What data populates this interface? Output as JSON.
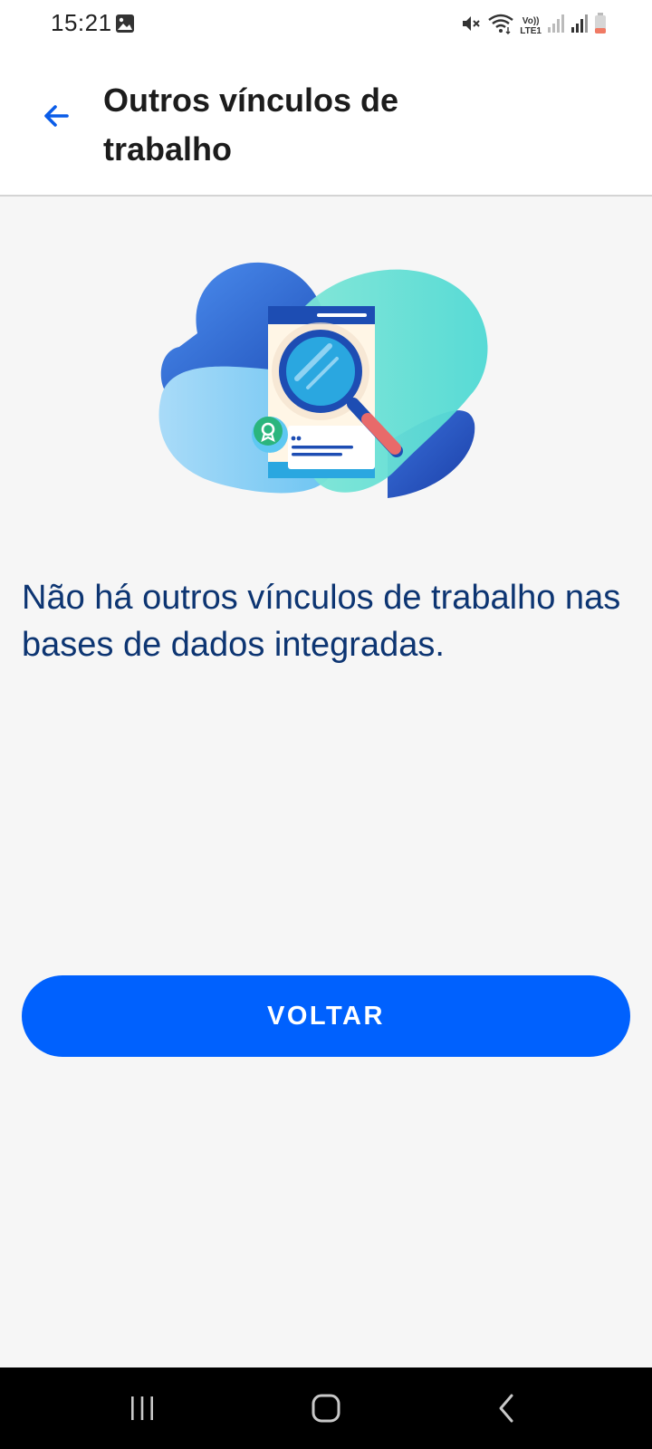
{
  "status_bar": {
    "time": "15:21",
    "icons": [
      "gallery-icon",
      "mute-icon",
      "wifi-icon",
      "volte-icon",
      "signal-icon",
      "signal-icon",
      "battery-icon"
    ],
    "volte_top": "Vo))",
    "volte_bottom": "LTE1"
  },
  "header": {
    "back_icon": "arrow-left-icon",
    "title": "Outros vínculos de trabalho",
    "accent_color": "#0a5ce8"
  },
  "illustration": {
    "icon": "document-search-illustration"
  },
  "main": {
    "message": "Não há outros vínculos de trabalho nas bases de dados integradas.",
    "message_color": "#0d3572"
  },
  "actions": {
    "back_label": "VOLTAR",
    "button_color": "#0061fe"
  },
  "nav_bar": {
    "items": [
      "recent-apps-icon",
      "home-icon",
      "back-icon"
    ]
  }
}
